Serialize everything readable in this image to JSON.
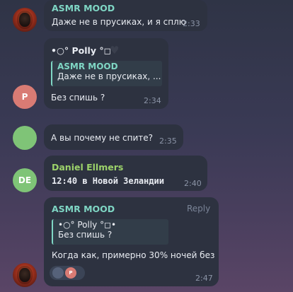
{
  "messages": [
    {
      "sender": "ASMR MOOD",
      "text": "Даже не в прусиках, и я сплю",
      "time": "2:33"
    },
    {
      "sender": "•○° Polly °◻•",
      "reply_to": {
        "sender": "ASMR MOOD",
        "text": "Даже не в прусиках, ..."
      },
      "text": "Без спишь ?",
      "time": "2:34",
      "avatar_letter": "P",
      "avatar_color": "#d97b74"
    },
    {
      "text": "А вы почему не спите?",
      "time": "2:35",
      "avatar_color": "#7fc477"
    },
    {
      "sender": "Daniel Ellmers",
      "text": "12:40 в Новой Зеландии",
      "time": "2:40",
      "avatar_letter": "DE",
      "avatar_color": "#7fc477"
    },
    {
      "sender": "ASMR MOOD",
      "reply_label": "Reply",
      "reply_to": {
        "sender": "•○° Polly °◻•",
        "text": "Без спишь ?"
      },
      "text": "Когда как, примерно 30% ночей без",
      "time": "2:47",
      "reaction_avatar_letter": "P"
    }
  ],
  "colors": {
    "accent": "#7fd6c4",
    "bubble": "#2d3240"
  }
}
